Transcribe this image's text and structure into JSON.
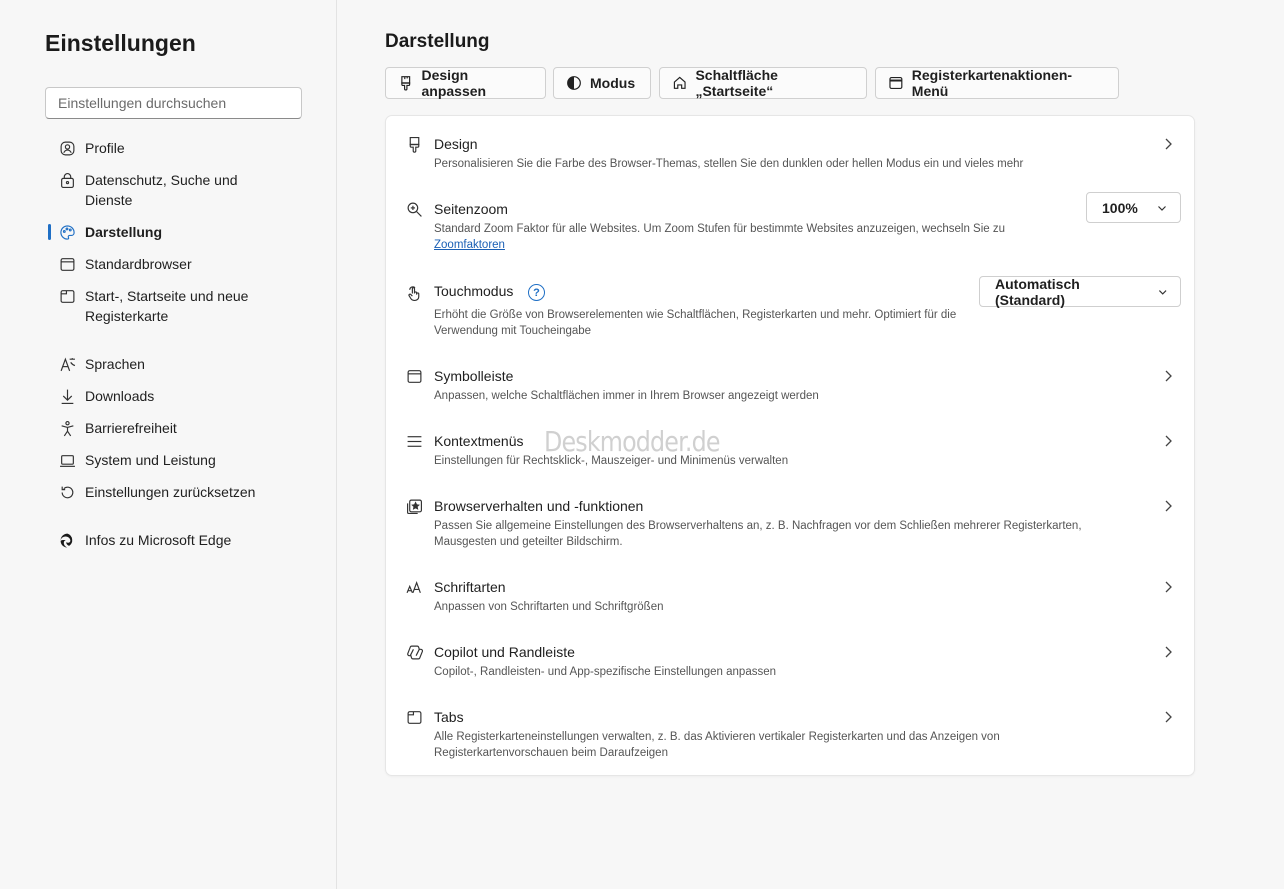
{
  "sidebar": {
    "title": "Einstellungen",
    "search_placeholder": "Einstellungen durchsuchen",
    "items": [
      {
        "label": "Profile",
        "icon": "profile-icon"
      },
      {
        "label": "Datenschutz, Suche und Dienste",
        "icon": "lock-icon"
      },
      {
        "label": "Darstellung",
        "icon": "palette-icon",
        "active": true
      },
      {
        "label": "Standardbrowser",
        "icon": "browser-icon"
      },
      {
        "label": "Start-, Startseite und neue Registerkarte",
        "icon": "newtab-icon"
      },
      {
        "label": "Sprachen",
        "icon": "language-icon"
      },
      {
        "label": "Downloads",
        "icon": "download-icon"
      },
      {
        "label": "Barrierefreiheit",
        "icon": "accessibility-icon"
      },
      {
        "label": "System und Leistung",
        "icon": "laptop-icon"
      },
      {
        "label": "Einstellungen zurücksetzen",
        "icon": "reset-icon"
      },
      {
        "label": "Infos zu Microsoft Edge",
        "icon": "edge-icon"
      }
    ]
  },
  "main": {
    "title": "Darstellung",
    "tabs": [
      {
        "label": "Design anpassen",
        "icon": "brush-icon"
      },
      {
        "label": "Modus",
        "icon": "contrast-icon"
      },
      {
        "label": "Schaltfläche „Startseite“",
        "icon": "home-icon"
      },
      {
        "label": "Registerkartenaktionen-Menü",
        "icon": "window-icon"
      }
    ],
    "rows": [
      {
        "title": "Design",
        "desc": "Personalisieren Sie die Farbe des Browser-Themas, stellen Sie den dunklen oder hellen Modus ein und vieles mehr",
        "icon": "brush-icon"
      },
      {
        "title": "Seitenzoom",
        "desc": "Standard Zoom Faktor für alle Websites. Um Zoom Stufen für bestimmte Websites anzuzeigen, wechseln Sie zu",
        "link": "Zoomfaktoren",
        "value": "100%",
        "icon": "zoom-icon"
      },
      {
        "title": "Touchmodus",
        "desc": "Erhöht die Größe von Browserelementen wie Schaltflächen, Registerkarten und mehr. Optimiert für die Verwendung mit Toucheingabe",
        "value": "Automatisch (Standard)",
        "help": "?",
        "icon": "touch-icon"
      },
      {
        "title": "Symbolleiste",
        "desc": "Anpassen, welche Schaltflächen immer in Ihrem Browser angezeigt werden",
        "icon": "toolbar-icon"
      },
      {
        "title": "Kontextmenüs",
        "desc": "Einstellungen für Rechtsklick-, Mauszeiger- und Minimenüs verwalten",
        "icon": "menu-icon"
      },
      {
        "title": "Browserverhalten und -funktionen",
        "desc": "Passen Sie allgemeine Einstellungen des Browserverhaltens an, z. B. Nachfragen vor dem Schließen mehrerer Registerkarten, Mausgesten und geteilter Bildschirm.",
        "icon": "features-icon"
      },
      {
        "title": "Schriftarten",
        "desc": "Anpassen von Schriftarten und Schriftgrößen",
        "icon": "font-icon"
      },
      {
        "title": "Copilot und Randleiste",
        "desc": "Copilot-, Randleisten- und App-spezifische Einstellungen anpassen",
        "icon": "copilot-icon"
      },
      {
        "title": "Tabs",
        "desc": "Alle Registerkarteneinstellungen verwalten, z. B. das Aktivieren vertikaler Registerkarten und das Anzeigen von Registerkartenvorschauen beim Daraufzeigen",
        "icon": "tabs-icon"
      }
    ]
  },
  "watermark": "Deskmodder.de",
  "colors": {
    "accent": "#1f6fc5",
    "link": "#1a5fb4",
    "background": "#f7f7f7"
  }
}
